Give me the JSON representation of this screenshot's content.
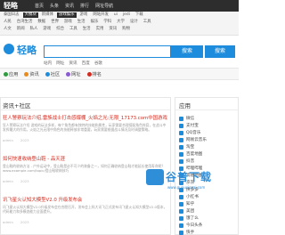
{
  "topbar": {
    "brand": "轻略",
    "menu": [
      "首页",
      "头条",
      "资讯",
      "排行",
      "网址导航"
    ]
  },
  "categories": {
    "row1": [
      "泰国日志",
      "大模块",
      "新媒体",
      "游戏娱乐",
      "游戏",
      "网站开发",
      "ui",
      "jedi",
      "下载"
    ],
    "row2": [
      "人民",
      "台湾生活",
      "数据",
      "世界",
      "游戏",
      "生活",
      "娱乐",
      "学科",
      "大学",
      "设计",
      "工具"
    ],
    "row3": [
      "人文",
      "新闻",
      "私人",
      "游戏",
      "综合",
      "工具",
      "生活",
      "实用",
      "资讯",
      "购物"
    ]
  },
  "logo": {
    "text": "轻略"
  },
  "search": {
    "button": "搜索",
    "button2": "搜索",
    "tabs": [
      "站内",
      "网址",
      "资讯",
      "百度",
      "谷歌"
    ]
  },
  "nav": {
    "items": [
      "应用",
      "资讯",
      "社区",
      "网址",
      "排名"
    ]
  },
  "main": {
    "title": "资讯+社区",
    "articles": [
      {
        "title": "狂人警察玩法介绍,雷族战士打击感爆棚_火焰之光:无限_17173.com中国游戏",
        "desc": "狂人警察玩法介绍 游戏的玩法多样，每个角色都有独特的技能和属性，玩家需要合理搭配角色阵容，在战斗中发挥最大的作用。火焰之光无限中角色的技能释放非常重要，玩家需要根据战斗情况及时调整策略。",
        "meta": [
          "admin",
          "2023"
        ]
      },
      {
        "title": "如何快速收纳登山鞋 - 品天涯",
        "desc": "登山鞋的收纳方法 - 户外运动中，登山鞋是必不可少的装备之一，如何正确收纳登山鞋才能延长使用寿命呢？www.example.com/topic/登山鞋收纳技巧",
        "meta": [
          "admin",
          "2023"
        ]
      },
      {
        "title": "讯飞星火认知大模型V2.0 升级发布会",
        "desc": "讯飞星火认知大模型V2.0升级发布会在合肥召开，发布会上科大讯飞正式发布讯飞星火认知大模型V2.0版本，代码能力和多模态能力全面提升。",
        "meta": [
          "admin",
          "2023"
        ]
      }
    ]
  },
  "side": {
    "title": "应用",
    "items": [
      "微信",
      "支付宝",
      "QQ音乐",
      "网易云音乐",
      "淘宝",
      "百度地图",
      "抖音",
      "哔哩哔哩",
      "高德地图",
      "京东",
      "拼多多",
      "小红书",
      "知乎",
      "美团",
      "饿了么",
      "今日头条",
      "快手"
    ]
  },
  "watermark": {
    "text": "谷普下载",
    "url": "www.gupuxiazai.com"
  },
  "colors": {
    "accent": "#1e8cdc",
    "title_red": "#d42b1e",
    "dark": "#2d2d2d",
    "green": "#2e9b3e"
  }
}
